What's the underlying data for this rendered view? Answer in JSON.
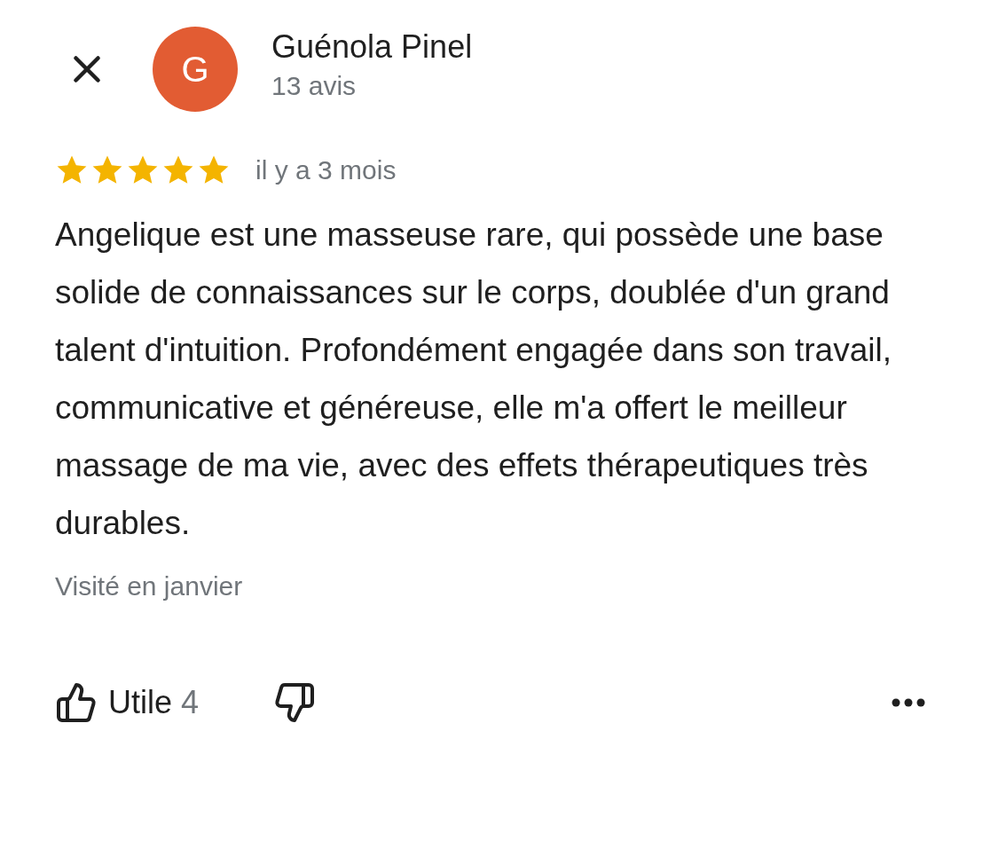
{
  "reviewer": {
    "avatar_letter": "G",
    "name": "Guénola Pinel",
    "review_count": "13 avis"
  },
  "review": {
    "stars": 5,
    "time": "il y a 3 mois",
    "text": "Angelique est une masseuse rare, qui possède une base solide de connaissances sur le corps, doublée d'un grand talent d'intuition. Profondément engagée dans son travail, communicative et généreuse, elle m'a offert le meilleur massage de ma vie, avec des effets thérapeutiques très durables.",
    "visited": "Visité en janvier"
  },
  "actions": {
    "helpful_label": "Utile",
    "helpful_count": "4"
  }
}
